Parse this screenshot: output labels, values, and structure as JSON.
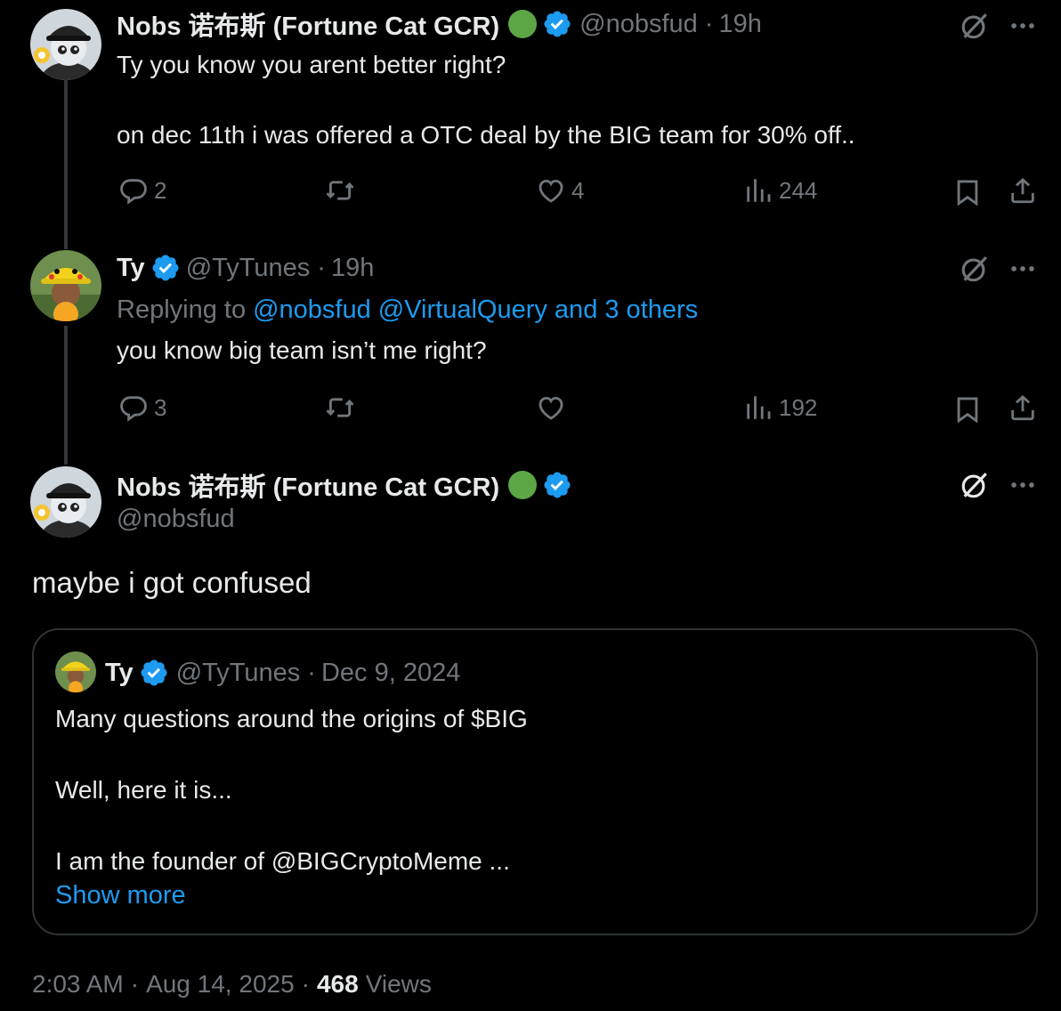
{
  "tweet1": {
    "name": "Nobs 诺布斯 (Fortune Cat GCR)",
    "handle": "@nobsfud",
    "sep": "·",
    "time": "19h",
    "line1": "Ty you know you arent better right?",
    "line2": "on dec 11th i was offered a OTC deal by the BIG team for 30% off..",
    "replies": "2",
    "likes": "4",
    "views": "244"
  },
  "tweet2": {
    "name": "Ty",
    "handle": "@TyTunes",
    "sep": "·",
    "time": "19h",
    "replying_prefix": "Replying to",
    "replying_links": "@nobsfud @VirtualQuery and 3 others",
    "body": "you know big team isn’t me right?",
    "replies": "3",
    "views": "192"
  },
  "main": {
    "name": "Nobs 诺布斯 (Fortune Cat GCR)",
    "handle": "@nobsfud",
    "body": "maybe i got confused"
  },
  "quote": {
    "name": "Ty",
    "handle": "@TyTunes",
    "sep": "·",
    "date": "Dec 9, 2024",
    "line1": "Many questions around the origins of $BIG",
    "line2": "Well, here it is...",
    "line3": "I am the founder of @BIGCryptoMeme ...",
    "show_more": "Show more"
  },
  "footer": {
    "time": "2:03 AM",
    "sep": "·",
    "date": "Aug 14, 2025",
    "sep2": "·",
    "views_count": "468",
    "views_label": "Views"
  },
  "colors": {
    "background": "#000000",
    "text": "#e7e9ea",
    "muted": "#71767b",
    "link": "#1d9bf0",
    "verified": "#1d9bf0",
    "green_dot": "#5ca646",
    "border": "#2f3336"
  },
  "icons": [
    "grok-icon",
    "more-icon",
    "verified-badge-icon",
    "reply-icon",
    "retweet-icon",
    "like-icon",
    "views-icon",
    "bookmark-icon",
    "share-icon"
  ]
}
